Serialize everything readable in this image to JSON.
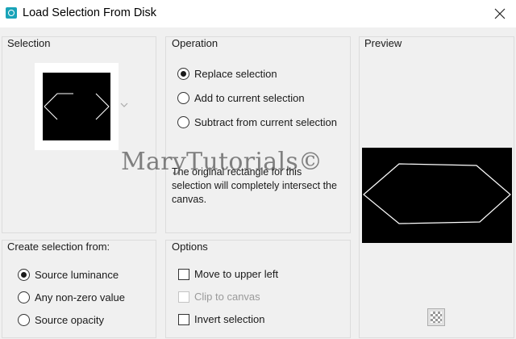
{
  "window": {
    "title": "Load Selection From Disk"
  },
  "selection_group": {
    "label": "Selection"
  },
  "operation_group": {
    "label": "Operation",
    "options": [
      {
        "label": "Replace selection",
        "checked": true
      },
      {
        "label": "Add to current selection",
        "checked": false
      },
      {
        "label": "Subtract from current selection",
        "checked": false
      }
    ],
    "description": "The original rectangle for this selection will completely intersect the canvas."
  },
  "preview_group": {
    "label": "Preview"
  },
  "create_group": {
    "label": "Create selection from:",
    "options": [
      {
        "label": "Source luminance",
        "checked": true
      },
      {
        "label": "Any non-zero value",
        "checked": false
      },
      {
        "label": "Source opacity",
        "checked": false
      }
    ]
  },
  "options_group": {
    "label": "Options",
    "items": [
      {
        "label": "Move to upper left",
        "checked": false,
        "enabled": true
      },
      {
        "label": "Clip to canvas",
        "checked": false,
        "enabled": false
      },
      {
        "label": "Invert selection",
        "checked": false,
        "enabled": true
      }
    ]
  },
  "watermark": "MaryTutorials©",
  "icons": {
    "app": "app-selection-icon",
    "close": "close-icon",
    "dropdown": "chevron-down-icon",
    "background": "checkerboard-icon"
  }
}
